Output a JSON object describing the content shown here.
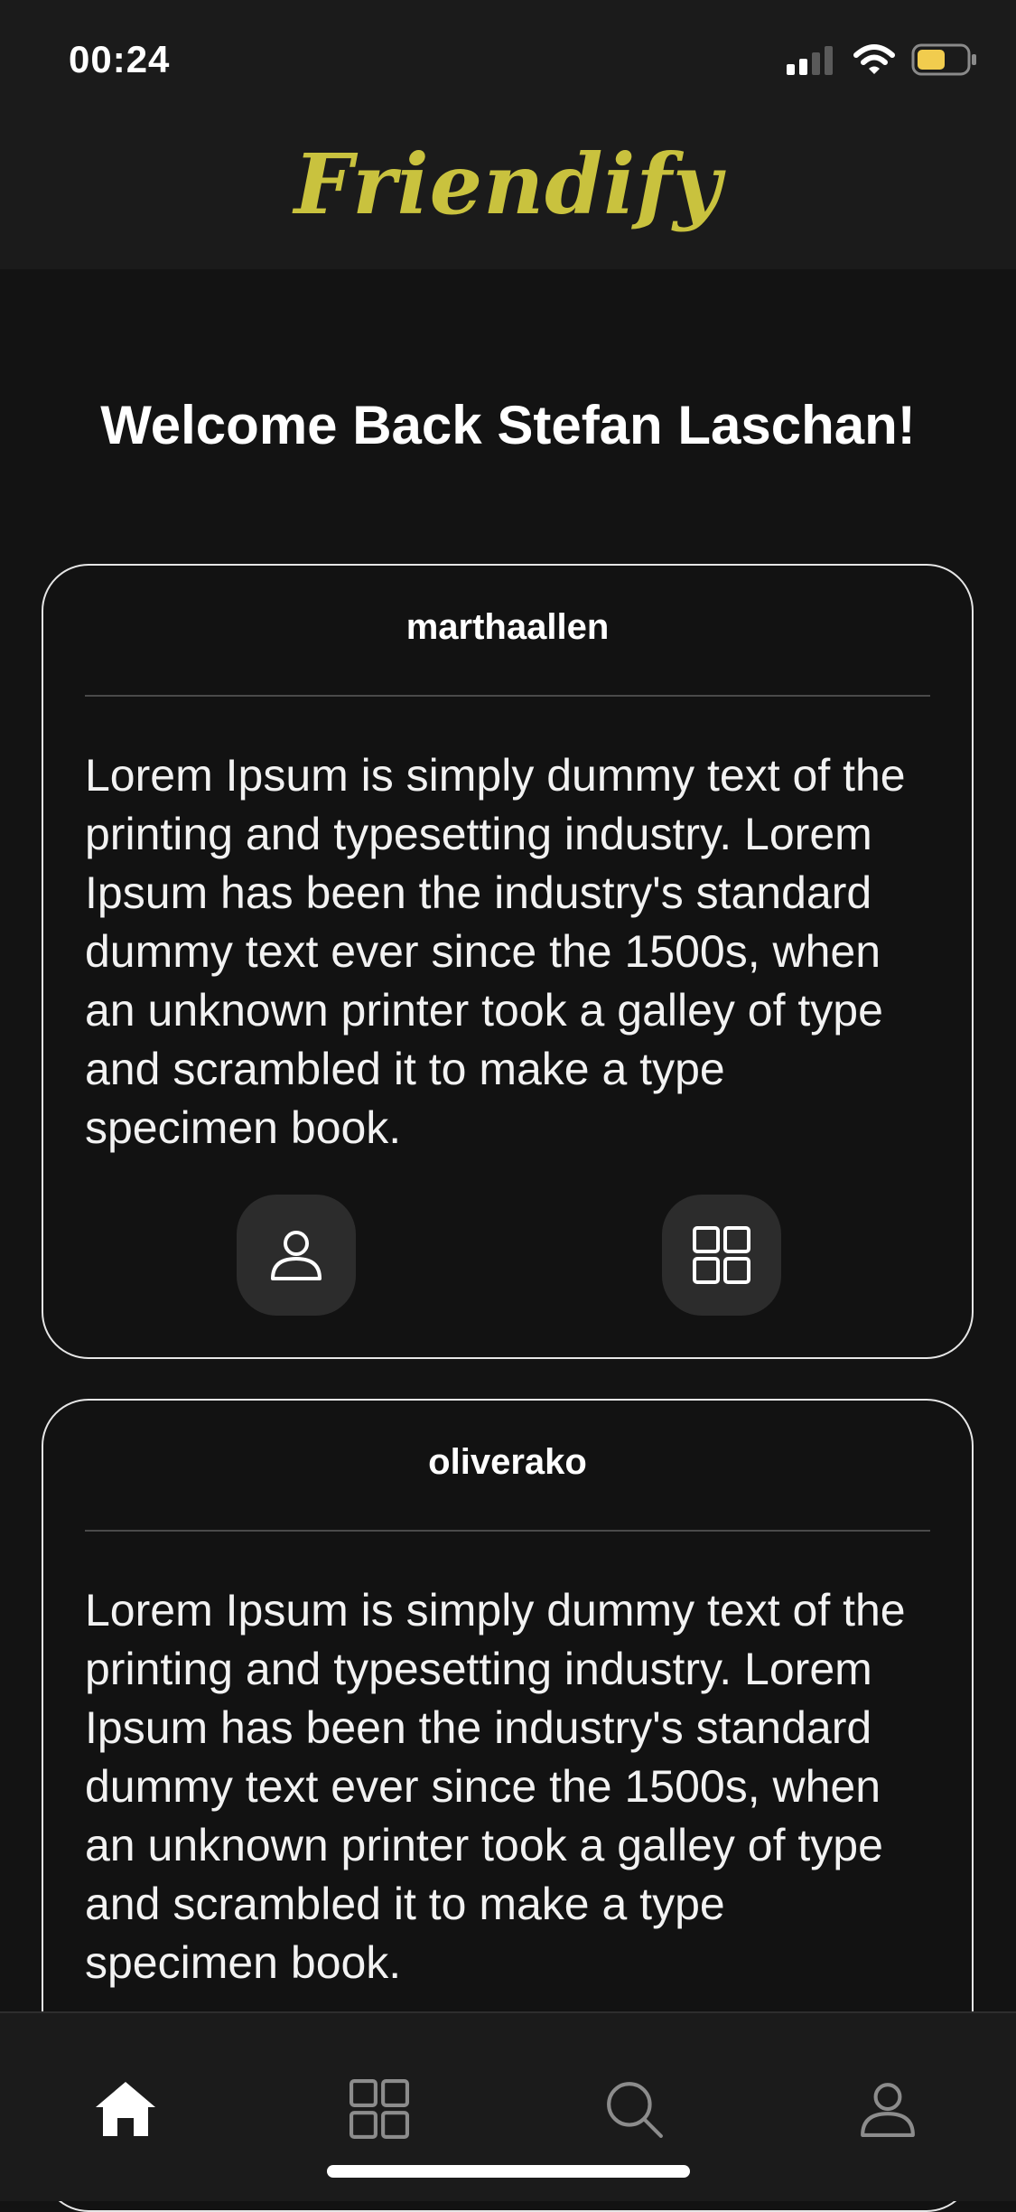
{
  "status_bar": {
    "time": "00:24"
  },
  "header": {
    "brand": "Friendify",
    "brand_color": "#c9c23e"
  },
  "welcome": "Welcome Back Stefan Laschan!",
  "posts": [
    {
      "username": "marthaallen",
      "text": "Lorem Ipsum is simply dummy text of the printing and typesetting industry. Lorem Ipsum has been the industry's standard dummy text ever since the 1500s, when an unknown printer took a galley of type and scrambled it to make a type specimen book.",
      "actions": [
        "person-icon",
        "grid-icon"
      ]
    },
    {
      "username": "oliverako",
      "text": "Lorem Ipsum is simply dummy text of the printing and typesetting industry. Lorem Ipsum has been the industry's standard dummy text ever since the 1500s, when an unknown printer took a galley of type and scrambled it to make a type specimen book."
    }
  ],
  "tabbar": {
    "items": [
      "home-icon",
      "grid-icon",
      "search-icon",
      "person-icon"
    ],
    "active": "home-icon"
  }
}
